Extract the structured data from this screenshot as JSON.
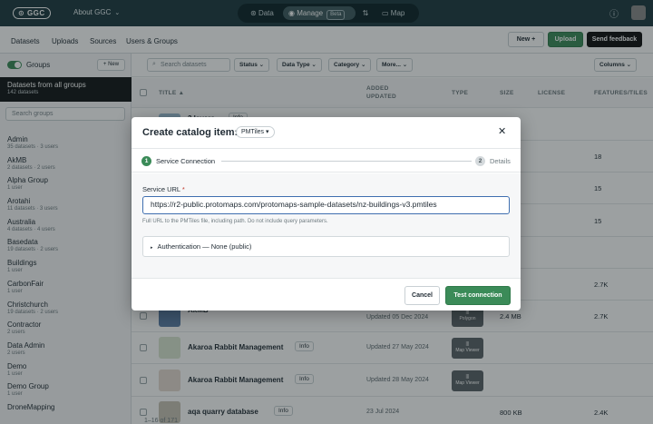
{
  "topbar": {
    "logo": "GGC",
    "about": "About GGC",
    "modes": [
      {
        "label": "Data"
      },
      {
        "label": "Manage",
        "badge": "Beta"
      },
      {
        "label": "Map"
      }
    ]
  },
  "nav": {
    "items": [
      "Datasets",
      "Uploads",
      "Sources",
      "Users & Groups"
    ],
    "new_label": "New",
    "upload_label": "Upload",
    "feedback_label": "Send feedback"
  },
  "sidebar": {
    "groups_label": "Groups",
    "new_label": "New",
    "all_groups_title": "Datasets from all groups",
    "all_groups_count": "142 datasets",
    "search_placeholder": "Search groups",
    "groups": [
      {
        "name": "Admin",
        "meta": "35 datasets · 3 users"
      },
      {
        "name": "AkMB",
        "meta": "2 datasets · 2 users"
      },
      {
        "name": "Alpha Group",
        "meta": "1 user"
      },
      {
        "name": "Arotahi",
        "meta": "11 datasets · 3 users"
      },
      {
        "name": "Australia",
        "meta": "4 datasets · 4 users"
      },
      {
        "name": "Basedata",
        "meta": "19 datasets · 2 users"
      },
      {
        "name": "Buildings",
        "meta": "1 user"
      },
      {
        "name": "CarbonFair",
        "meta": "1 user"
      },
      {
        "name": "Christchurch",
        "meta": "19 datasets · 2 users"
      },
      {
        "name": "Contractor",
        "meta": "2 users"
      },
      {
        "name": "Data Admin",
        "meta": "2 users"
      },
      {
        "name": "Demo",
        "meta": "1 user"
      },
      {
        "name": "Demo Group",
        "meta": "1 user"
      },
      {
        "name": "DroneMapping",
        "meta": ""
      }
    ]
  },
  "main": {
    "search_placeholder": "Search datasets",
    "filters": [
      "Status",
      "Data Type",
      "Category",
      "More..."
    ],
    "columns_label": "Columns",
    "headers": {
      "title": "TITLE",
      "added": "ADDED",
      "updated": "UPDATED",
      "type": "TYPE",
      "size": "SIZE",
      "license": "LICENSE",
      "features": "FEATURES/TILES"
    },
    "rows": [
      {
        "name": "3 layers",
        "info": "Info",
        "date": "",
        "type": "",
        "size": "",
        "features": ""
      },
      {
        "name": "",
        "info": "",
        "date": "",
        "type": "",
        "size": "",
        "features": "18"
      },
      {
        "name": "",
        "info": "",
        "date": "",
        "type": "",
        "size": "",
        "features": "15"
      },
      {
        "name": "",
        "info": "",
        "date": "",
        "type": "",
        "size": "",
        "features": "15"
      },
      {
        "name": "",
        "info": "",
        "date": "",
        "type": "",
        "size": "",
        "features": ""
      },
      {
        "name": "",
        "info": "",
        "date": "",
        "type": "",
        "size": "",
        "features": "2.7K"
      },
      {
        "name": "AkMB",
        "info": "",
        "date": "Updated 05 Dec 2024",
        "date_top": "05 Dec 2024",
        "type": "Polygon",
        "size": "2.4 MB",
        "features": "2.7K"
      },
      {
        "name": "Akaroa Rabbit Management",
        "info": "Info",
        "date": "Updated 27 May 2024",
        "type": "Map Viewer",
        "size": "",
        "features": ""
      },
      {
        "name": "Akaroa Rabbit Management",
        "info": "Info",
        "date": "Updated 28 May 2024",
        "type": "Map Viewer",
        "size": "",
        "features": ""
      },
      {
        "name": "aqa quarry database",
        "info": "Info",
        "date": "23 Jul 2024",
        "type": "",
        "size": "800 KB",
        "features": "2.4K"
      }
    ],
    "footer": "1–16 of 171"
  },
  "modal": {
    "title": "Create catalog item:",
    "type_pill": "PMTiles",
    "steps": [
      {
        "num": "1",
        "label": "Service Connection"
      },
      {
        "num": "2",
        "label": "Details"
      }
    ],
    "url_label": "Service URL",
    "url_required": "*",
    "url_value": "https://r2-public.protomaps.com/protomaps-sample-datasets/nz-buildings-v3.pmtiles",
    "url_help": "Full URL to the PMTiles file, including path. Do not include query parameters.",
    "auth_label": "Authentication — None (public)",
    "cancel_label": "Cancel",
    "test_label": "Test connection"
  },
  "colors": {
    "topbar": "#1e3a40",
    "accent_green": "#3b8b58",
    "focus_blue": "#3f6fb0"
  }
}
